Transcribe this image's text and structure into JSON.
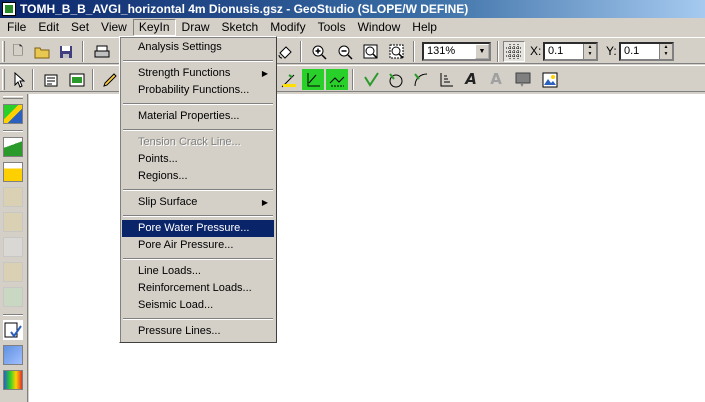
{
  "window": {
    "title": "TOMH_B_B_AVGI_horizontal 4m Dionusis.gsz - GeoStudio (SLOPE/W DEFINE)"
  },
  "menubar": [
    "File",
    "Edit",
    "Set",
    "View",
    "KeyIn",
    "Draw",
    "Sketch",
    "Modify",
    "Tools",
    "Window",
    "Help"
  ],
  "toolbar": {
    "zoom_value": "131%",
    "x_label": "X:",
    "x_value": "0.1",
    "y_label": "Y:",
    "y_value": "0.1"
  },
  "keyin_menu": {
    "items": [
      {
        "label": "Analysis Settings"
      },
      {
        "label": "Strength Functions",
        "arrow": "▶"
      },
      {
        "label": "Probability Functions..."
      },
      {
        "label": "Material Properties..."
      },
      {
        "label": "Tension Crack Line...",
        "state": "disabled"
      },
      {
        "label": "Points..."
      },
      {
        "label": "Regions..."
      },
      {
        "label": "Slip Surface",
        "arrow": "▶"
      },
      {
        "label": "Pore Water Pressure...",
        "state": "highlighted"
      },
      {
        "label": "Pore Air Pressure..."
      },
      {
        "label": "Line Loads..."
      },
      {
        "label": "Reinforcement Loads..."
      },
      {
        "label": "Seismic Load..."
      },
      {
        "label": "Pressure Lines..."
      }
    ]
  }
}
